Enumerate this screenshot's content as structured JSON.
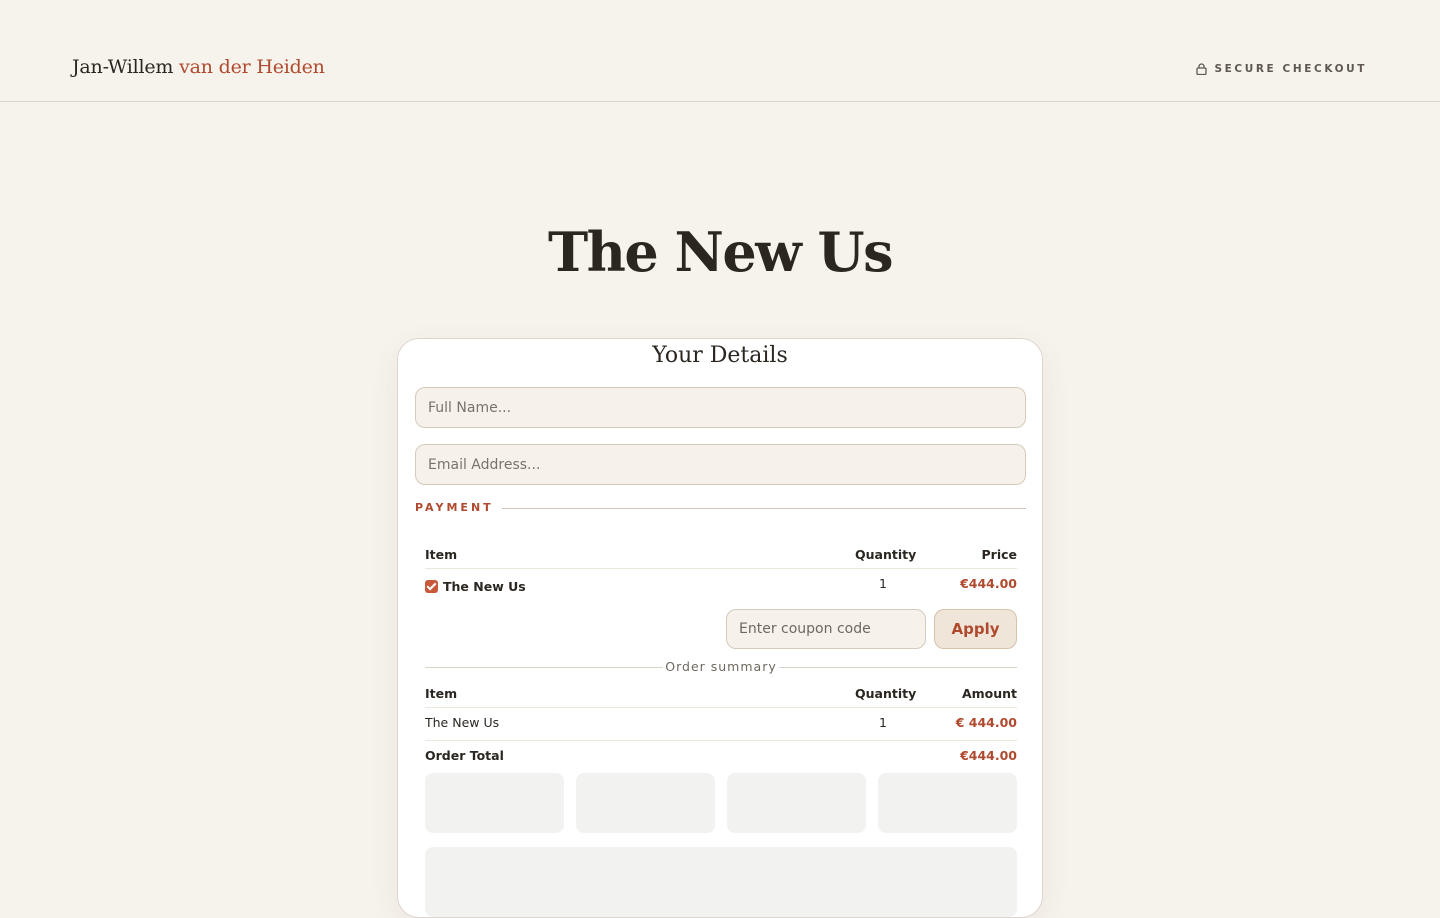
{
  "header": {
    "brand_first": "Jan-Willem ",
    "brand_accent": "van der Heiden",
    "secure_label": "SECURE CHECKOUT"
  },
  "page": {
    "title": "The New Us"
  },
  "details": {
    "title": "Your Details",
    "name_placeholder": "Full Name...",
    "email_placeholder": "Email Address..."
  },
  "payment": {
    "section_label": "PAYMENT",
    "columns": {
      "item": "Item",
      "quantity": "Quantity",
      "price": "Price"
    },
    "items": [
      {
        "name": "The New Us",
        "quantity": "1",
        "price": "€444.00",
        "checked": true
      }
    ],
    "coupon_placeholder": "Enter coupon code",
    "apply_label": "Apply"
  },
  "summary": {
    "label": "Order summary",
    "columns": {
      "item": "Item",
      "quantity": "Quantity",
      "amount": "Amount"
    },
    "rows": [
      {
        "name": "The New Us",
        "quantity": "1",
        "amount": "€ 444.00"
      }
    ],
    "total_label": "Order Total",
    "total_value": "€444.00"
  },
  "colors": {
    "accent": "#b04a2e",
    "background": "#f6f2ec",
    "field_bg": "#f6f1ea"
  }
}
